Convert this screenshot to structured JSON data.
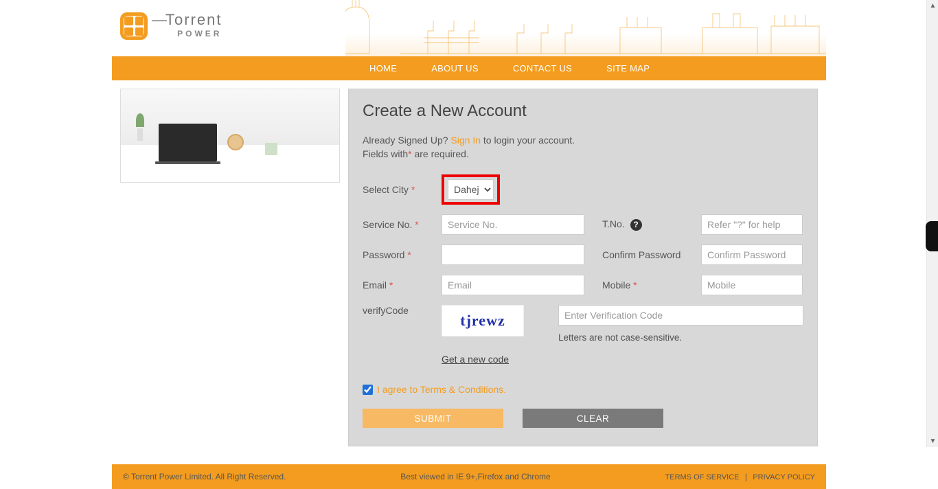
{
  "brand": {
    "name1": "Torrent",
    "name2": "POWER"
  },
  "nav": {
    "home": "HOME",
    "about": "ABOUT US",
    "contact": "CONTACT US",
    "sitemap": "SITE MAP"
  },
  "form": {
    "title": "Create a New Account",
    "already_pre": "Already Signed Up? ",
    "signin": "Sign In",
    "already_post": " to login your account.",
    "fields_with": "Fields with",
    "are_required": " are required.",
    "labels": {
      "city": "Select City ",
      "service": "Service No. ",
      "tno": "T.No. ",
      "password": "Password ",
      "confirm": "Confirm Password",
      "email": "Email ",
      "mobile": "Mobile ",
      "verify": "verifyCode"
    },
    "city_value": "Dahej",
    "placeholders": {
      "service": "Service No.",
      "tno": "Refer \"?\" for help",
      "confirm": "Confirm Password",
      "email": "Email",
      "mobile": "Mobile",
      "captcha": "Enter Verification Code"
    },
    "captcha_text": "tjrewz",
    "captcha_note": "Letters are not case-sensitive.",
    "new_code": "Get a new code",
    "terms": "I agree to Terms & Conditions.",
    "terms_checked": true,
    "submit": "SUBMIT",
    "clear": "CLEAR"
  },
  "footer": {
    "copyright": "© Torrent Power Limited. All Right Reserved.",
    "browser": "Best viewed in IE 9+,Firefox and Chrome",
    "tos": "TERMS OF SERVICE",
    "privacy": "PRIVACY POLICY"
  }
}
